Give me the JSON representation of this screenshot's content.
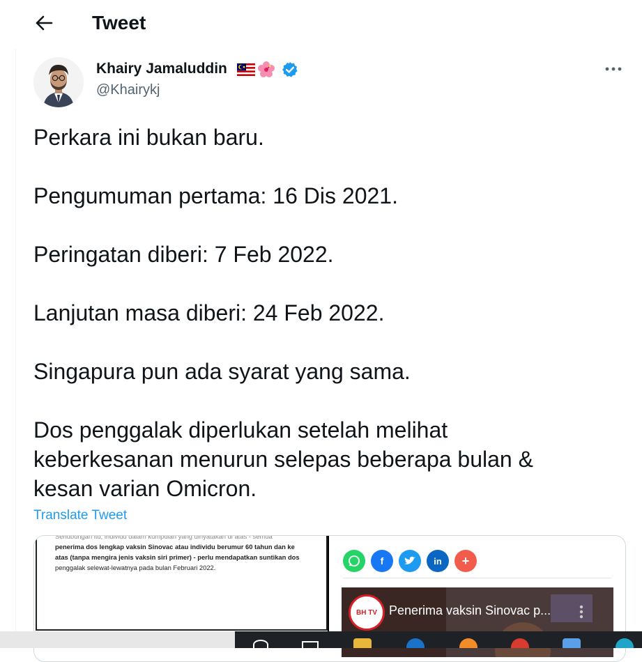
{
  "header": {
    "title": "Tweet",
    "back_icon": "arrow-left-icon"
  },
  "author": {
    "display_name": "Khairy Jamaluddin",
    "handle": "@Khairykj",
    "badges": [
      "malaysia-flag-icon",
      "hibiscus-icon",
      "verified-badge-icon"
    ],
    "verified_color": "#1d9bf0"
  },
  "tweet": {
    "lines": [
      "Perkara ini bukan baru.",
      "",
      "Pengumuman pertama: 16 Dis 2021.",
      "",
      "Peringatan diberi: 7 Feb 2022.",
      "",
      "Lanjutan masa diberi: 24 Feb 2022.",
      "",
      "Singapura pun ada syarat yang sama.",
      "",
      "Dos penggalak diperlukan setelah melihat",
      "keberkesanan menurun selepas beberapa bulan &",
      "kesan varian Omicron."
    ],
    "translate_label": "Translate Tweet"
  },
  "media": {
    "doc_lines": [
      "Sehubungan itu, individu dalam kumpulan yang dinyatakan di atas - semua",
      "penerima dos lengkap vaksin Sinovac atau individu berumur 60 tahun dan ke",
      "atas (tanpa mengira jenis vaksin siri primer) - perlu mendapatkan suntikan dos",
      "penggalak selewat-lewatnya pada bulan Februari 2022."
    ],
    "video_title": "Penerima vaksin Sinovac p...",
    "video_logo": "BH TV"
  },
  "colors": {
    "link": "#1d9bf0",
    "text": "#0f1419",
    "secondary": "#536471",
    "whatsapp": "#25d366",
    "facebook": "#1877f2",
    "twitter": "#1d9bf0",
    "linkedin": "#0a66c2",
    "more_share": "#f25c4c"
  }
}
